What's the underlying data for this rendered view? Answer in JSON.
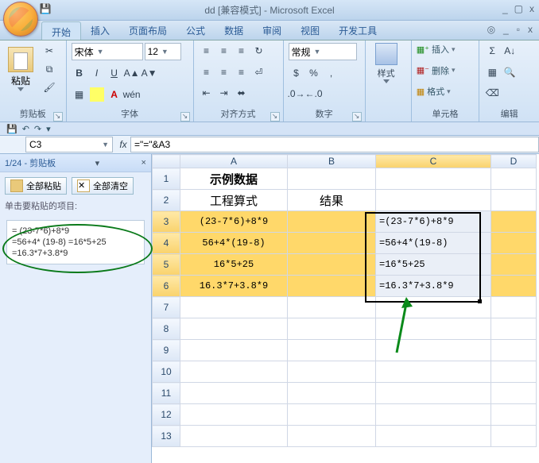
{
  "window": {
    "title": "dd [兼容模式] - Microsoft Excel"
  },
  "tabs": {
    "items": [
      "开始",
      "插入",
      "页面布局",
      "公式",
      "数据",
      "审阅",
      "视图",
      "开发工具"
    ],
    "active_index": 0
  },
  "ribbon": {
    "clipboard": {
      "paste": "粘贴",
      "label": "剪贴板"
    },
    "font": {
      "name": "宋体",
      "size": "12",
      "label": "字体",
      "bold": "B",
      "italic": "I",
      "underline": "U"
    },
    "align": {
      "label": "对齐方式"
    },
    "number": {
      "format": "常规",
      "label": "数字",
      "percent": "%",
      "comma": ","
    },
    "styles": {
      "label": "样式"
    },
    "cells": {
      "insert": "插入",
      "delete": "删除",
      "format": "格式",
      "label": "单元格"
    },
    "editing": {
      "label": "编辑"
    }
  },
  "namebox": "C3",
  "formula": "=\"=\"&A3",
  "sidebar": {
    "title": "1/24 - 剪贴板",
    "paste_all": "全部粘贴",
    "clear_all": "全部清空",
    "hint": "单击要粘贴的项目:",
    "item": "= (23-7*6)+8*9\n=56+4* (19-8) =16*5+25\n=16.3*7+3.8*9"
  },
  "columns": [
    "A",
    "B",
    "C",
    "D"
  ],
  "rows": [
    1,
    2,
    3,
    4,
    5,
    6,
    7,
    8,
    9,
    10,
    11,
    12,
    13
  ],
  "cells": {
    "A1": "示例数据",
    "A2": "工程算式",
    "B2": "结果",
    "A3": "(23-7*6)+8*9",
    "C3": "=(23-7*6)+8*9",
    "A4": "56+4*(19-8)",
    "C4": "=56+4*(19-8)",
    "A5": "16*5+25",
    "C5": "=16*5+25",
    "A6": "16.3*7+3.8*9",
    "C6": "=16.3*7+3.8*9"
  },
  "chart_data": null
}
